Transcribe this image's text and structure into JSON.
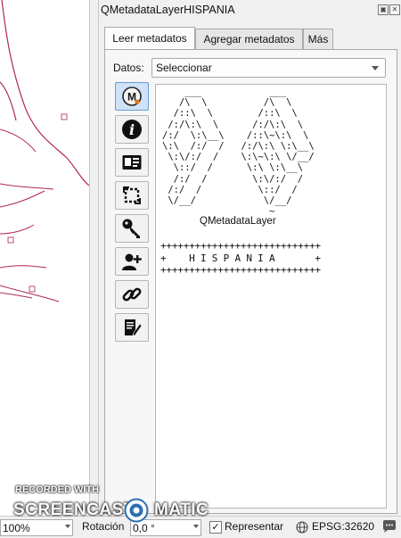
{
  "panel": {
    "title": "QMetadataLayerHISPANIA",
    "float_button": "▣",
    "close_button": "✕"
  },
  "tabs": [
    {
      "label": "Leer metadatos",
      "active": true
    },
    {
      "label": "Agregar metadatos",
      "active": false
    },
    {
      "label": "Más",
      "active": false
    }
  ],
  "datos": {
    "label": "Datos:",
    "selected": "Seleccionar"
  },
  "toolbar": [
    {
      "icon": "qmetadata-logo-icon",
      "active": true
    },
    {
      "icon": "info-icon"
    },
    {
      "icon": "id-card-icon"
    },
    {
      "icon": "crop-rotate-icon"
    },
    {
      "icon": "key-icon"
    },
    {
      "icon": "add-user-icon"
    },
    {
      "icon": "link-icon"
    },
    {
      "icon": "script-edit-icon"
    }
  ],
  "content": {
    "ascii_art": "    ___            ___\n   /\\  \\          /\\  \\\n  /::\\  \\        /::\\  \\\n /:/\\:\\  \\      /:/\\:\\  \\\n/:/  \\:\\__\\    /::\\~\\:\\  \\\n\\:\\  /:/  /   /:/\\:\\ \\:\\__\\\n \\:\\/:/  /    \\:\\~\\:\\ \\/__/\n  \\::/  /      \\:\\ \\:\\__\\\n  /:/  /        \\:\\/:/  /\n /:/  /          \\::/  /\n \\/__/            \\/__/\n                   ~",
    "ascii_name": "QMetadataLayer",
    "banner": "++++++++++++++++++++++++++++\n+    H I S P A N I A       +\n++++++++++++++++++++++++++++"
  },
  "statusbar": {
    "scale_value": "100%",
    "rotation_label": "Rotación",
    "rotation_value": "0,0 °",
    "render_checked": "✓",
    "render_label": "Representar",
    "crs": "EPSG:32620"
  },
  "watermark": {
    "line1": "RECORDED WITH",
    "line2a": "SCREENCAST",
    "line2b": "MATIC"
  },
  "colors": {
    "map_line": "#b0284f",
    "active_tool": "#cfe2f7"
  }
}
